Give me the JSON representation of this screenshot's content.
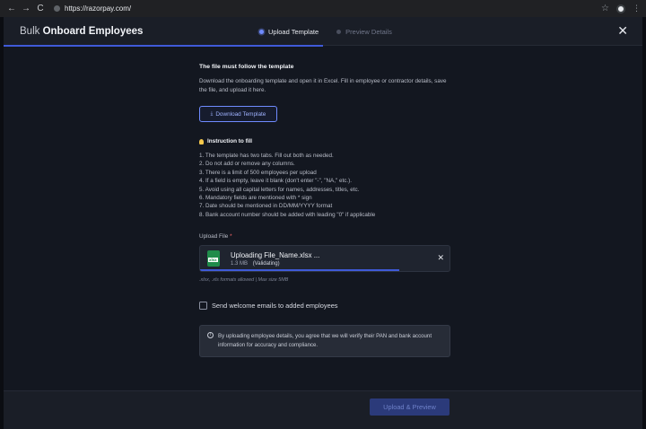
{
  "browser": {
    "url": "https://razorpay.com/",
    "back_icon": "←",
    "forward_icon": "→",
    "reload_icon": "C"
  },
  "header": {
    "title_prefix": "Bulk",
    "title_bold": "Onboard Employees",
    "steps": [
      {
        "label": "Upload Template",
        "state": "active"
      },
      {
        "label": "Preview Details",
        "state": "inactive"
      }
    ],
    "close_icon": "✕",
    "progress_fraction": 0.5
  },
  "template": {
    "heading": "The file must follow the template",
    "description": "Download the onboarding template and open it in Excel. Fill in employee or contractor details, save the file, and upload it here.",
    "download_icon": "⤓",
    "download_label": "Download Template"
  },
  "instructions": {
    "title": "Instruction to fill",
    "items": [
      "1. The template has two tabs. Fill out both as needed.",
      "2. Do not add or remove any columns.",
      "3. There is a limit of 500 employees per upload",
      "4. If a field is empty, leave it blank (don't enter \"-\", \"NA,\" etc.).",
      "5. Avoid using all capital letters for names, addresses, titles, etc.",
      "6. Mandatory fields are mentioned with * sign",
      "7. Date should be mentioned in DD/MM/YYYY format",
      "8. Bank account number should be added with leading \"0\" if applicable"
    ]
  },
  "upload": {
    "label": "Upload File",
    "required_mark": "*",
    "file_icon_text": "xlsx",
    "file_name": "Uploading File_Name.xlsx ...",
    "file_size": "1.3 MB",
    "file_status": "(Validating)",
    "remove_icon": "✕",
    "progress_fraction": 0.8,
    "hint": ".xlsx, .xls formats allowed | Max size 5MB"
  },
  "welcome_checkbox": {
    "label": "Send welcome emails to added employees",
    "checked": false
  },
  "notice": {
    "icon": "i",
    "text": "By uploading employee details, you agree that we will verify their PAN and bank account information for accuracy and compliance."
  },
  "footer": {
    "primary_label": "Upload & Preview"
  }
}
